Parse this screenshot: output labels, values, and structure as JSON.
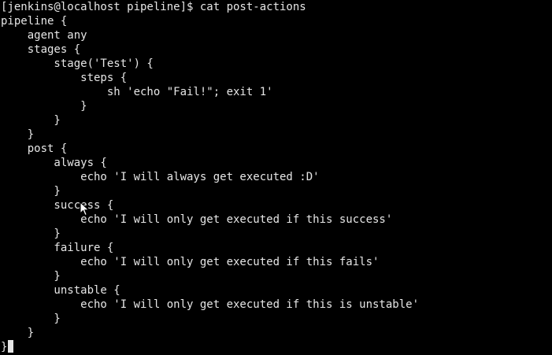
{
  "terminal": {
    "lines": [
      "[jenkins@localhost pipeline]$ cat post-actions",
      "pipeline {",
      "    agent any",
      "    stages {",
      "        stage('Test') {",
      "            steps {",
      "                sh 'echo \"Fail!\"; exit 1'",
      "            }",
      "        }",
      "    }",
      "    post {",
      "        always {",
      "            echo 'I will always get executed :D'",
      "        }",
      "        success {",
      "            echo 'I will only get executed if this success'",
      "        }",
      "        failure {",
      "            echo 'I will only get executed if this fails'",
      "        }",
      "        unstable {",
      "            echo 'I will only get executed if this is unstable'",
      "        }",
      "    }",
      "}"
    ]
  },
  "colors": {
    "background": "#000000",
    "foreground": "#e6e6e6"
  },
  "icons": {
    "cursor": "text-cursor-icon",
    "pointer": "mouse-pointer-icon"
  }
}
